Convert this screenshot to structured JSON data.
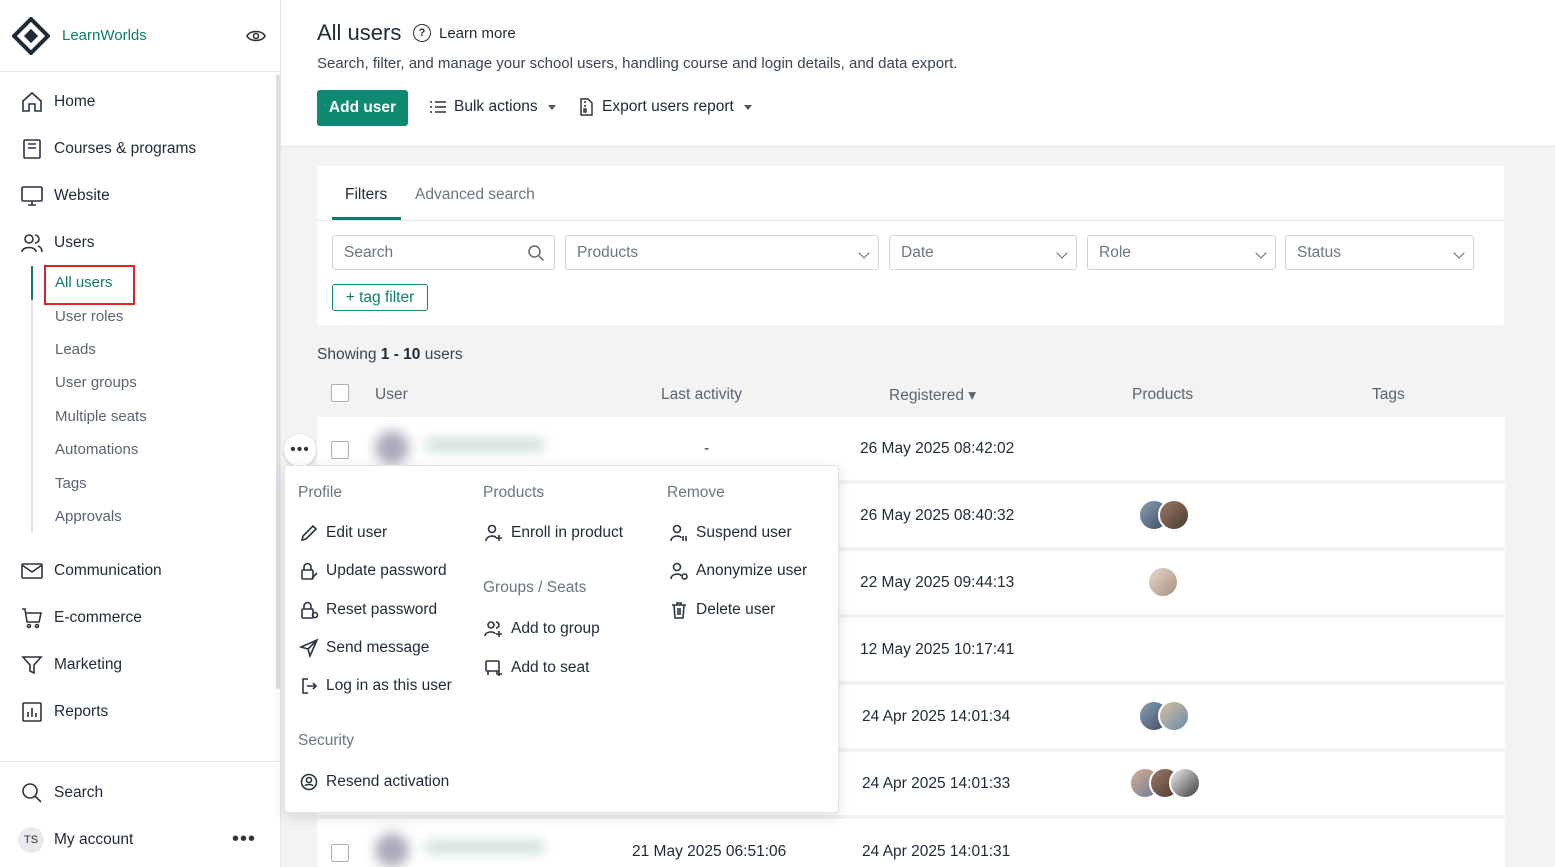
{
  "app": {
    "brand": "LearnWorlds"
  },
  "sidebar": {
    "items": [
      {
        "label": "Home",
        "icon": "home-icon"
      },
      {
        "label": "Courses & programs",
        "icon": "book-icon"
      },
      {
        "label": "Website",
        "icon": "monitor-icon"
      },
      {
        "label": "Users",
        "icon": "users-icon"
      }
    ],
    "sub_items": [
      "All users",
      "User roles",
      "Leads",
      "User groups",
      "Multiple seats",
      "Automations",
      "Tags",
      "Approvals"
    ],
    "items_lower": [
      {
        "label": "Communication",
        "icon": "mail-icon"
      },
      {
        "label": "E-commerce",
        "icon": "cart-icon"
      },
      {
        "label": "Marketing",
        "icon": "funnel-icon"
      },
      {
        "label": "Reports",
        "icon": "chart-icon"
      }
    ],
    "bottom": {
      "search": "Search",
      "account": "My account",
      "initials": "TS"
    }
  },
  "header": {
    "title": "All users",
    "learn_more": "Learn more",
    "description": "Search, filter, and manage your school users, handling course and login details, and data export.",
    "add_user": "Add user",
    "bulk_actions": "Bulk actions",
    "export": "Export users report"
  },
  "filters": {
    "tabs": [
      "Filters",
      "Advanced search"
    ],
    "search_placeholder": "Search",
    "products": "Products",
    "date": "Date",
    "role": "Role",
    "status": "Status",
    "tag_filter": "+ tag filter"
  },
  "table": {
    "showing_prefix": "Showing ",
    "showing_range": "1 - 10",
    "showing_suffix": " users",
    "columns": [
      "User",
      "Last activity",
      "Registered ▾",
      "Products",
      "Tags"
    ],
    "rows": [
      {
        "last_activity": "-",
        "registered": "26 May 2025 08:42:02"
      },
      {
        "last_activity": "",
        "registered": "26 May 2025 08:40:32"
      },
      {
        "last_activity": "",
        "registered": "22 May 2025 09:44:13"
      },
      {
        "last_activity": "",
        "registered": "12 May 2025 10:17:41"
      },
      {
        "last_activity": "",
        "registered": "24 Apr 2025 14:01:34"
      },
      {
        "last_activity": "",
        "registered": "24 Apr 2025 14:01:33"
      },
      {
        "last_activity": "21 May 2025 06:51:06",
        "registered": "24 Apr 2025 14:01:31"
      }
    ]
  },
  "menu": {
    "profile_head": "Profile",
    "profile": [
      "Edit user",
      "Update password",
      "Reset password",
      "Send message",
      "Log in as this user"
    ],
    "products_head": "Products",
    "products": [
      "Enroll in product"
    ],
    "groups_head": "Groups / Seats",
    "groups": [
      "Add to group",
      "Add to seat"
    ],
    "remove_head": "Remove",
    "remove": [
      "Suspend user",
      "Anonymize user",
      "Delete user"
    ],
    "security_head": "Security",
    "security": [
      "Resend activation"
    ]
  },
  "colors": {
    "accent": "#0e8a73",
    "highlight": "#e02424"
  }
}
